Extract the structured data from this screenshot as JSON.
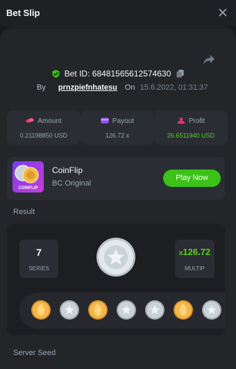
{
  "header": {
    "title": "Bet Slip",
    "close_icon": "close-icon"
  },
  "bet": {
    "id_label": "Bet ID:",
    "id": "68481565612574630",
    "by_label": "By",
    "user": "prnzpiefnhatesu",
    "on_label": "On",
    "date": "15.6.2022, 01:31:37",
    "icons": {
      "share": "share-icon",
      "verified": "shield-check-icon",
      "copy": "copy-icon"
    }
  },
  "stats": {
    "amount": {
      "label": "Amount",
      "value": "0.21198850 USD",
      "icon": "coins-icon",
      "icon_color": "#e0336d"
    },
    "payout": {
      "label": "Payout",
      "value": "126.72 x",
      "icon": "wallet-icon",
      "icon_color": "#9a52f5"
    },
    "profit": {
      "label": "Profit",
      "value": "26.6511940 USD",
      "icon": "profit-icon",
      "icon_color": "#e0336d"
    }
  },
  "game": {
    "name": "CoinFlip",
    "provider": "BC Original",
    "play_label": "Play Now",
    "thumb_text": "COINFLIP"
  },
  "result": {
    "label": "Result",
    "series_value": "7",
    "series_label": "SERIES",
    "multiplier_value": "126.72",
    "multiplier_prefix": "x",
    "multiplier_label": "MULTIP",
    "coins": [
      "gold",
      "silver",
      "gold",
      "silver",
      "silver",
      "gold",
      "silver"
    ]
  },
  "server_seed_label": "Server Seed",
  "colors": {
    "accent_green": "#3bc117",
    "gold": "#f2b84b",
    "silver": "#c9d2d6"
  }
}
